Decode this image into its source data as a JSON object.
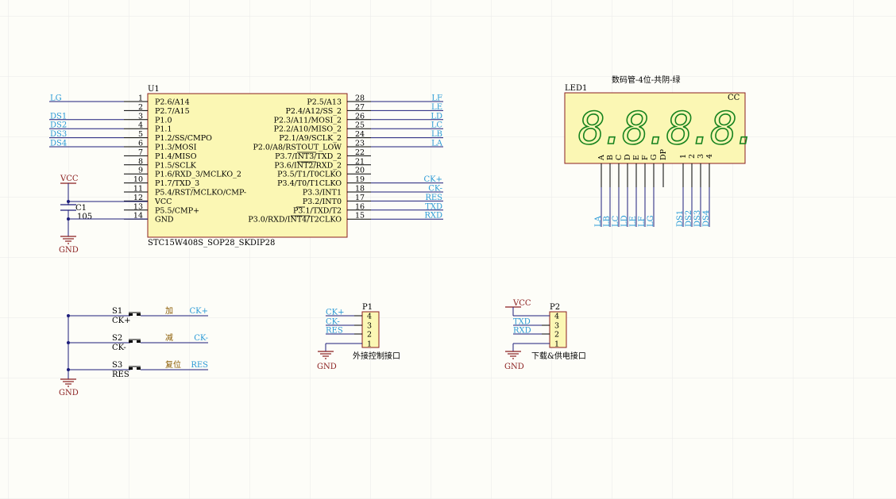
{
  "colors": {
    "background": "#fdfdf8",
    "grid": "#ececec",
    "component_fill": "#fbf7b4",
    "component_border": "#8a1e1e",
    "wire": "#1d1d7a",
    "net_label": "#2a9ad6",
    "power_label": "#8a1e1e",
    "segment_display": "#17831f"
  },
  "u1": {
    "designator": "U1",
    "part_name": "STC15W408S_SOP28_SKDIP28",
    "left_pins": [
      {
        "num": "1",
        "name": "P2.6/A14",
        "net": "LG"
      },
      {
        "num": "2",
        "name": "P2.7/A15",
        "net": ""
      },
      {
        "num": "3",
        "name": "P1.0",
        "net": "DS1"
      },
      {
        "num": "4",
        "name": "P1.1",
        "net": "DS2"
      },
      {
        "num": "5",
        "name": "P1.2/SS/CMPO",
        "net": "DS3"
      },
      {
        "num": "6",
        "name": "P1.3/MOSI",
        "net": "DS4"
      },
      {
        "num": "7",
        "name": "P1.4/MISO",
        "net": ""
      },
      {
        "num": "8",
        "name": "P1.5/SCLK",
        "net": ""
      },
      {
        "num": "9",
        "name": "P1.6/RXD_3/MCLKO_2",
        "net": ""
      },
      {
        "num": "10",
        "name": "P1.7/TXD_3",
        "net": ""
      },
      {
        "num": "11",
        "name": "P5.4/RST/MCLKO/CMP-",
        "net": ""
      },
      {
        "num": "12",
        "name": "VCC",
        "net": ""
      },
      {
        "num": "13",
        "name": "P5.5/CMP+",
        "net": ""
      },
      {
        "num": "14",
        "name": "GND",
        "net": ""
      }
    ],
    "right_pins": [
      {
        "num": "28",
        "name": "P2.5/A13",
        "net": "LF"
      },
      {
        "num": "27",
        "name": "P2.4/A12/SS_2",
        "net": "LE"
      },
      {
        "num": "26",
        "name": "P2.3/A11/MOSI_2",
        "net": "LD"
      },
      {
        "num": "25",
        "name": "P2.2/A10/MISO_2",
        "net": "LC"
      },
      {
        "num": "24",
        "name": "P2.1/A9/SCLK_2",
        "net": "LB"
      },
      {
        "num": "23",
        "name": "P2.0/A8/RSTOUT_LOW",
        "net": "LA"
      },
      {
        "num": "22",
        "name": "P3.7/INT3/TXD_2",
        "net": ""
      },
      {
        "num": "21",
        "name": "P3.6/INT2/RXD_2",
        "net": ""
      },
      {
        "num": "20",
        "name": "P3.5/T1/T0CLKO",
        "net": ""
      },
      {
        "num": "19",
        "name": "P3.4/T0/T1CLKO",
        "net": "CK+"
      },
      {
        "num": "18",
        "name": "P3.3/INT1",
        "net": "CK-"
      },
      {
        "num": "17",
        "name": "P3.2/INT0",
        "net": "RES"
      },
      {
        "num": "16",
        "name": "P3.1/TXD/T2",
        "net": "TXD"
      },
      {
        "num": "15",
        "name": "P3.0/RXD/INT4/T2CLKO",
        "net": "RXD"
      }
    ]
  },
  "power": {
    "vcc": "VCC",
    "gnd": "GND"
  },
  "capacitor": {
    "designator": "C1",
    "value": "105"
  },
  "led1": {
    "designator": "LED1",
    "title": "数码管-4位-共阴-绿",
    "cc_label": "CC",
    "digits": "8.8.8.8.",
    "segment_pins": [
      "A",
      "B",
      "C",
      "D",
      "E",
      "F",
      "G",
      "DP"
    ],
    "digit_pins": [
      "1",
      "2",
      "3",
      "4"
    ],
    "segment_nets": [
      "LA",
      "LB",
      "LC",
      "LD",
      "LE",
      "LF",
      "LG"
    ],
    "digit_nets": [
      "DS1",
      "DS2",
      "DS3",
      "DS4"
    ]
  },
  "switches": [
    {
      "designator": "S1",
      "net_name": "CK+",
      "caption": "加",
      "net_label": "CK+"
    },
    {
      "designator": "S2",
      "net_name": "CK-",
      "caption": "减",
      "net_label": "CK-"
    },
    {
      "designator": "S3",
      "net_name": "RES",
      "caption": "复位",
      "net_label": "RES"
    }
  ],
  "p1": {
    "designator": "P1",
    "caption": "外接控制接口",
    "pins": [
      "4",
      "3",
      "2",
      "1"
    ],
    "nets": [
      "CK+",
      "CK-",
      "RES"
    ],
    "gnd": "GND"
  },
  "p2": {
    "designator": "P2",
    "caption": "下载&供电接口",
    "pins": [
      "4",
      "3",
      "2",
      "1"
    ],
    "nets": [
      "VCC",
      "TXD",
      "RXD"
    ],
    "gnd": "GND"
  }
}
